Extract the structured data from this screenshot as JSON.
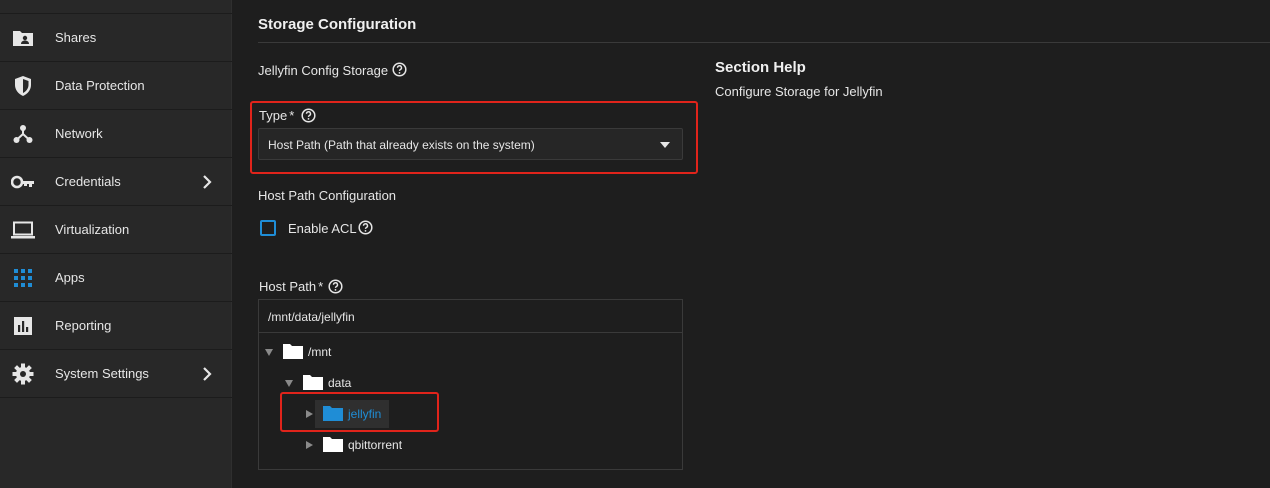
{
  "sidebar": {
    "items": [
      {
        "label": "Shares",
        "icon": "folder-person-icon"
      },
      {
        "label": "Data Protection",
        "icon": "shield-icon"
      },
      {
        "label": "Network",
        "icon": "network-icon"
      },
      {
        "label": "Credentials",
        "icon": "key-icon",
        "has_submenu": true
      },
      {
        "label": "Virtualization",
        "icon": "laptop-icon"
      },
      {
        "label": "Apps",
        "icon": "apps-grid-icon"
      },
      {
        "label": "Reporting",
        "icon": "bar-chart-icon"
      },
      {
        "label": "System Settings",
        "icon": "gear-icon",
        "has_submenu": true
      }
    ]
  },
  "main": {
    "section_title": "Storage Configuration",
    "config_storage_label": "Jellyfin Config Storage",
    "type_label": "Type",
    "type_required": "*",
    "type_value": "Host Path (Path that already exists on the system)",
    "host_path_config_label": "Host Path Configuration",
    "enable_acl_label": "Enable ACL",
    "enable_acl_checked": false,
    "host_path_label": "Host Path",
    "host_path_required": "*",
    "host_path_value": "/mnt/data/jellyfin",
    "tree": [
      {
        "label": "/mnt",
        "expanded": true
      },
      {
        "label": "data",
        "expanded": true
      },
      {
        "label": "jellyfin",
        "expanded": false,
        "selected": true
      },
      {
        "label": "qbittorrent",
        "expanded": false
      }
    ]
  },
  "help": {
    "title": "Section Help",
    "text": "Configure Storage for Jellyfin"
  },
  "colors": {
    "accent": "#1f8dd6",
    "highlight": "#e0241b",
    "background": "#1e1e1e",
    "sidebar": "#282828"
  }
}
